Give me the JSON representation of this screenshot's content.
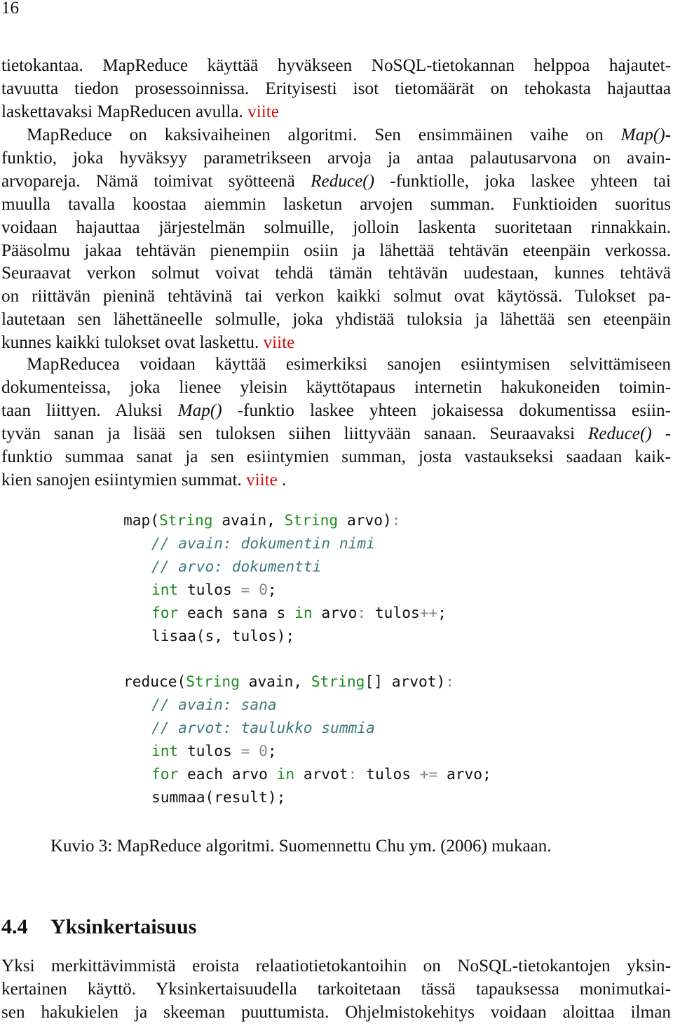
{
  "page": {
    "number": "16"
  },
  "paragraphs": {
    "p1": {
      "lines": [
        "tietokantaa. MapReduce käyttää hyväkseen NoSQL-tietokannan helppoa hajautet-",
        "tavuutta tiedon prosessoinnissa. Erityisesti isot tietomäärät on tehokasta hajauttaa",
        "laskettavaksi MapReducen avulla."
      ],
      "ref": "viite"
    },
    "p2": {
      "l1": "MapReduce on kaksivaiheinen algoritmi. Sen ensimmäinen vaihe on",
      "l1_em": "Map()",
      "l1_end": "-",
      "l2": "funktio, joka hyväksyy parametrikseen arvoja ja antaa palautusarvona on avain-",
      "l3_a": "arvopareja. Nämä toimivat syötteenä",
      "l3_em": "Reduce()",
      "l3_b": "-funktiolle, joka laskee yhteen tai",
      "rest": [
        "muulla tavalla koostaa aiemmin lasketun arvojen summan. Funktioiden suoritus",
        "voidaan hajauttaa järjestelmän solmuille, jolloin laskenta suoritetaan rinnakkain.",
        "Pääsolmu jakaa tehtävän pienempiin osiin ja lähettää tehtävän eteenpäin verkossa.",
        "Seuraavat verkon solmut voivat tehdä tämän tehtävän uudestaan, kunnes tehtävä",
        "on riittävän pieninä tehtävinä tai verkon kaikki solmut ovat käytössä. Tulokset pa-",
        "lautetaan sen lähettäneelle solmulle, joka yhdistää tuloksia ja lähettää sen eteenpäin"
      ],
      "last": "kunnes kaikki tulokset ovat laskettu.",
      "ref": "viite"
    },
    "p3": {
      "l1": "MapReducea voidaan käyttää esimerkiksi sanojen esiintymisen selvittämiseen",
      "l2": "dokumenteissa, joka lienee yleisin käyttötapaus internetin hakukoneiden toimin-",
      "l3_a": "taan liittyen. Aluksi",
      "l3_em": "Map()",
      "l3_b": "-funktio laskee yhteen jokaisessa dokumentissa esiin-",
      "l4_a": "tyvän sanan ja lisää sen tuloksen siihen liittyvään sanaan. Seuraavaksi",
      "l4_em": "Reduce()",
      "l4_b": "-",
      "l5": "funktio summaa sanat ja sen esiintymien summan, josta vastaukseksi saadaan kaik-",
      "l6": "kien sanojen esiintymien summat.",
      "ref": "viite",
      "end": "."
    },
    "p4": {
      "lines": [
        "Yksi merkittävimmistä eroista relaatiotietokantoihin on NoSQL-tietokantojen yksin-",
        "kertainen käyttö. Yksinkertaisuudella tarkoitetaan tässä tapauksessa monimutkai-",
        "sen hakukielen ja skeeman puuttumista. Ohjelmistokehitys voidaan aloittaa ilman"
      ]
    }
  },
  "code": {
    "map": {
      "fn": "map(",
      "t1": "String",
      "a1": " avain, ",
      "t2": "String",
      "a2": " arvo)",
      "colon": ":",
      "c1": "// avain: dokumentin nimi",
      "c2": "// arvo: dokumentti",
      "kw_int": "int",
      "decl": " tulos ",
      "eq": "= 0",
      "semi": ";",
      "kw_for": "for",
      "loop_a": " each sana s ",
      "kw_in": "in",
      "loop_b": " arvo",
      "loop_colon": ":",
      "loop_c": " tulos",
      "pp": "++",
      "loop_end": ";",
      "call": "lisaa(s, tulos);"
    },
    "reduce": {
      "fn": "reduce(",
      "t1": "String",
      "a1": " avain, ",
      "t2": "String",
      "a2": "[] arvot)",
      "colon": ":",
      "c1": "// avain: sana",
      "c2": "// arvot: taulukko summia",
      "kw_int": "int",
      "decl": " tulos ",
      "eq": "= 0",
      "semi": ";",
      "kw_for": "for",
      "loop_a": " each arvo ",
      "kw_in": "in",
      "loop_b": " arvot",
      "loop_colon": ":",
      "loop_c": " tulos ",
      "pe": "+=",
      "loop_end": " arvo;",
      "call": "summaa(result);"
    },
    "colors": {
      "keyword": "#1e8a1e",
      "comment": "#3d7a7a",
      "operator": "#888888"
    }
  },
  "caption": "Kuvio 3: MapReduce algoritmi. Suomennettu Chu ym. (2006) mukaan.",
  "section": {
    "number": "4.4",
    "title": "Yksinkertaisuus"
  },
  "colors": {
    "reference": "#cc1010",
    "text": "#111111"
  }
}
